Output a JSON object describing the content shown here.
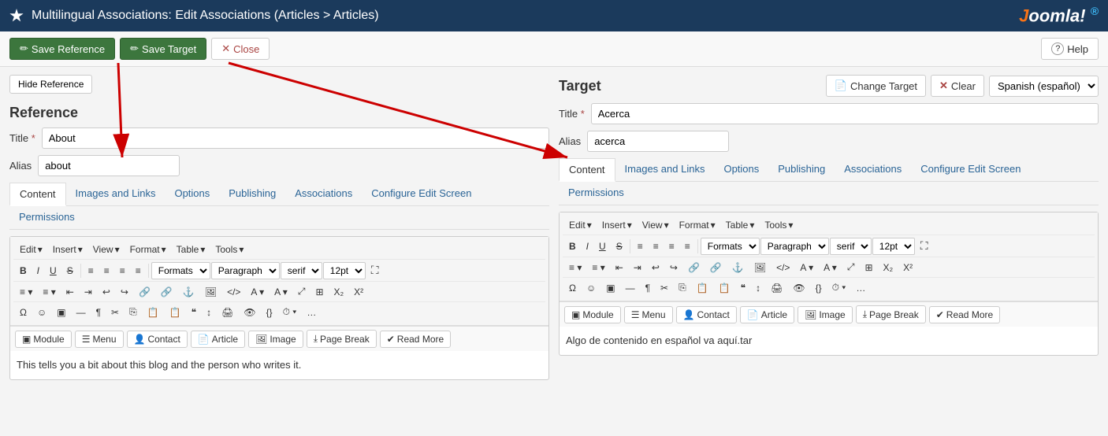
{
  "topbar": {
    "title": "Multilingual Associations: Edit Associations (Articles > Articles)",
    "logo": "Joomla!"
  },
  "toolbar": {
    "save_reference_label": "Save Reference",
    "save_target_label": "Save Target",
    "close_label": "Close",
    "help_label": "Help"
  },
  "reference": {
    "section_label": "Reference",
    "hide_btn": "Hide Reference",
    "title_label": "Title",
    "alias_label": "Alias",
    "title_value": "About",
    "alias_value": "about",
    "tabs": [
      "Content",
      "Images and Links",
      "Options",
      "Publishing",
      "Associations",
      "Configure Edit Screen",
      "Permissions"
    ]
  },
  "target": {
    "section_label": "Target",
    "change_target_label": "Change Target",
    "clear_label": "Clear",
    "language_label": "Spanish (español)",
    "title_label": "Title",
    "alias_label": "Alias",
    "title_value": "Acerca",
    "alias_value": "acerca",
    "tabs": [
      "Content",
      "Images and Links",
      "Options",
      "Publishing",
      "Associations",
      "Configure Edit Screen",
      "Permissions"
    ]
  },
  "editor_ref": {
    "menus": [
      "Edit",
      "Insert",
      "View",
      "Format",
      "Table",
      "Tools"
    ],
    "formats_dropdown": "Formats",
    "paragraph_dropdown": "Paragraph",
    "font_dropdown": "serif",
    "size_dropdown": "12pt",
    "bottom_buttons": [
      "Module",
      "Menu",
      "Contact",
      "Article",
      "Image",
      "Page Break",
      "Read More"
    ],
    "content": "This tells you a bit about this blog and the person who writes it."
  },
  "editor_target": {
    "menus": [
      "Edit",
      "Insert",
      "View",
      "Format",
      "Table",
      "Tools"
    ],
    "formats_dropdown": "Formats",
    "paragraph_dropdown": "Paragraph",
    "font_dropdown": "serif",
    "size_dropdown": "12pt",
    "bottom_buttons": [
      "Module",
      "Menu",
      "Contact",
      "Article",
      "Image",
      "Page Break",
      "Read More"
    ],
    "content": "Algo de contenido en español va aquí.tar"
  },
  "icons": {
    "save": "💾",
    "close_x": "✕",
    "help_q": "?",
    "change_target": "📄",
    "clear_x": "✕",
    "chevron_down": "▾"
  }
}
